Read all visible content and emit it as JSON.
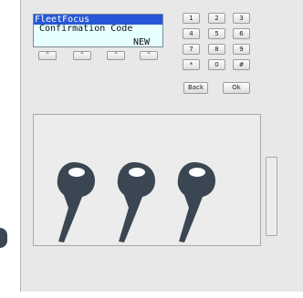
{
  "display": {
    "title": "FleetFocus",
    "line2": "Confirmation Code",
    "line3": "NEW"
  },
  "soft_keys": [
    "^",
    "^",
    "^",
    "^"
  ],
  "keypad": {
    "rows": [
      [
        "1",
        "2",
        "3"
      ],
      [
        "4",
        "5",
        "6"
      ],
      [
        "7",
        "8",
        "9"
      ],
      [
        "*",
        "0",
        "#"
      ]
    ],
    "back_label": "Back",
    "ok_label": "Ok"
  },
  "keys": [
    "key-icon",
    "key-icon",
    "key-icon"
  ],
  "colors": {
    "lcd_background": "#e6ffff",
    "lcd_highlight": "#2757d8",
    "key_icon": "#3a4652"
  }
}
